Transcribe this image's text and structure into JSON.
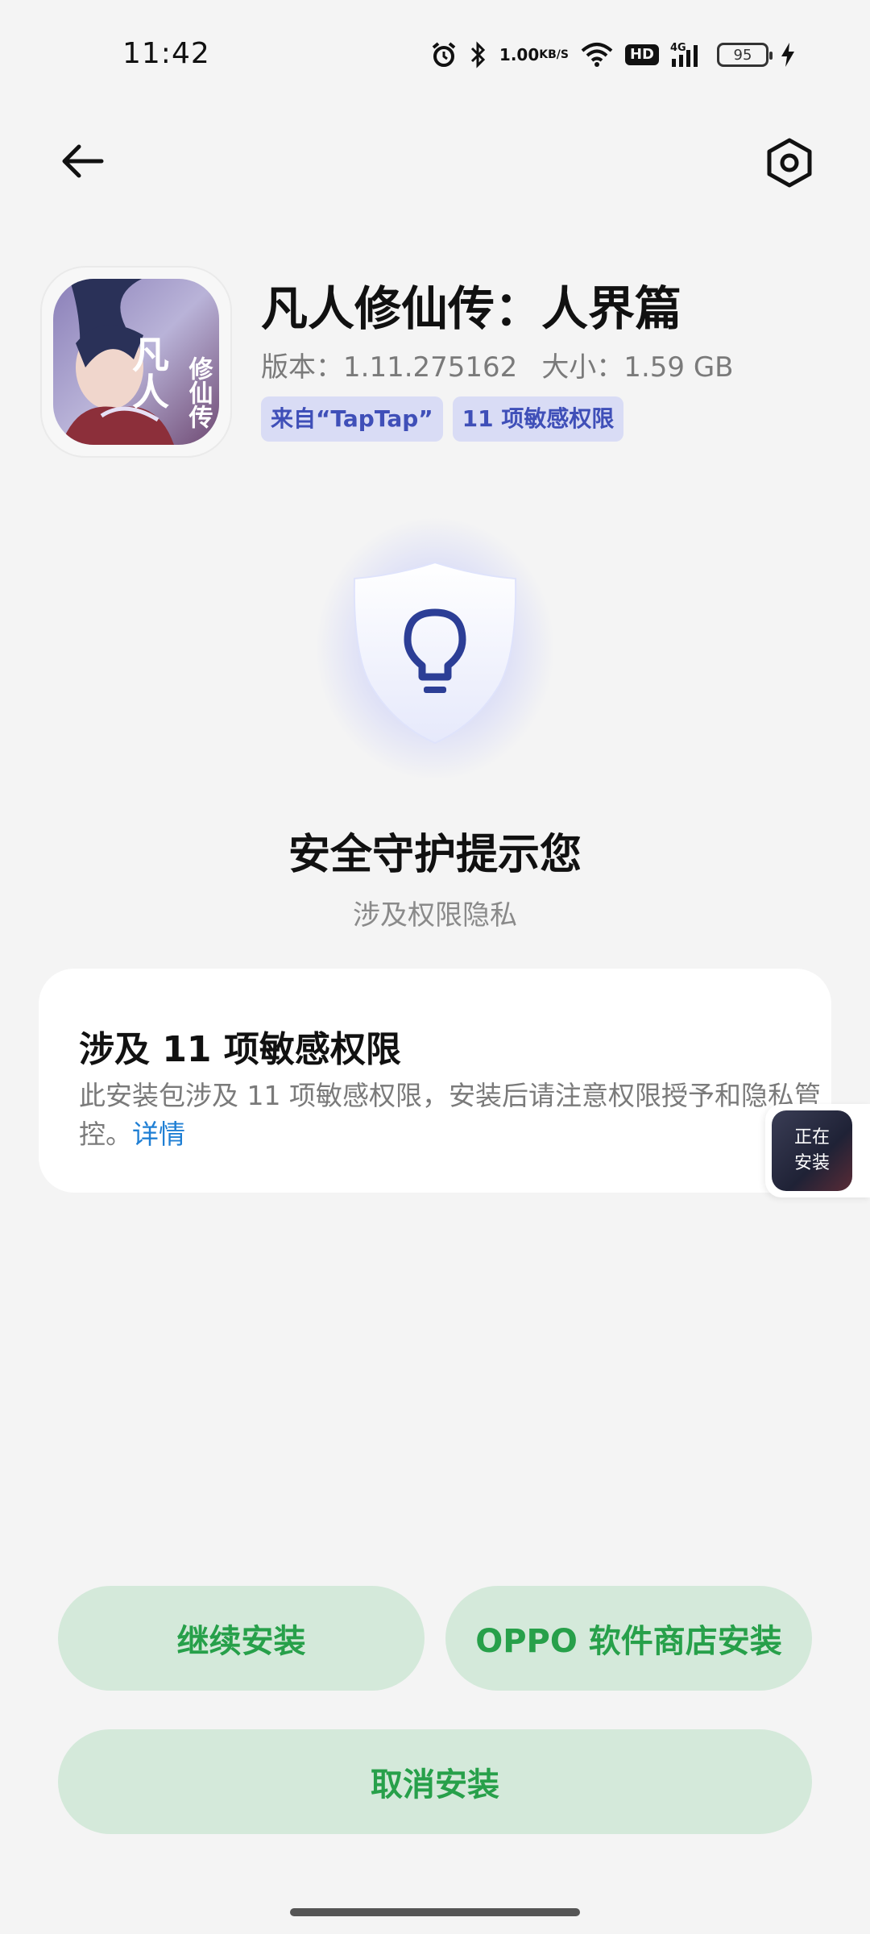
{
  "status_bar": {
    "time": "11:42",
    "net_speed": "1.00",
    "net_speed_unit": "KB/S",
    "hd_badge": "HD",
    "network_type": "4G",
    "battery_level": "95",
    "icons": [
      "alarm-icon",
      "bluetooth-icon",
      "wifi-icon",
      "signal-icon",
      "charging-icon"
    ]
  },
  "nav": {
    "back_icon": "arrow-left-icon",
    "settings_icon": "hex-settings-icon"
  },
  "app": {
    "name": "凡人修仙传：人界篇",
    "version": "版本：1.11.275162",
    "size": "大小：1.59 GB",
    "tags": [
      "来自“TapTap”",
      "11 项敏感权限"
    ],
    "icon_title": "凡人",
    "icon_subtitle": "修仙传"
  },
  "guard": {
    "title": "安全守护提示您",
    "subtitle": "涉及权限隐私",
    "icon": "shield-lightbulb-icon",
    "accent": "#5a66e8"
  },
  "card": {
    "title": "涉及 11 项敏感权限",
    "body": "此安装包涉及 11 项敏感权限，安装后请注意权限授予和隐私管控。",
    "link": "详情"
  },
  "floating": {
    "line1": "正在",
    "line2": "安装"
  },
  "buttons": {
    "continue": "继续安装",
    "oppo_store": "OPPO 软件商店安装",
    "cancel": "取消安装",
    "bg_color": "#d4e9da",
    "text_color": "#27a04a"
  }
}
